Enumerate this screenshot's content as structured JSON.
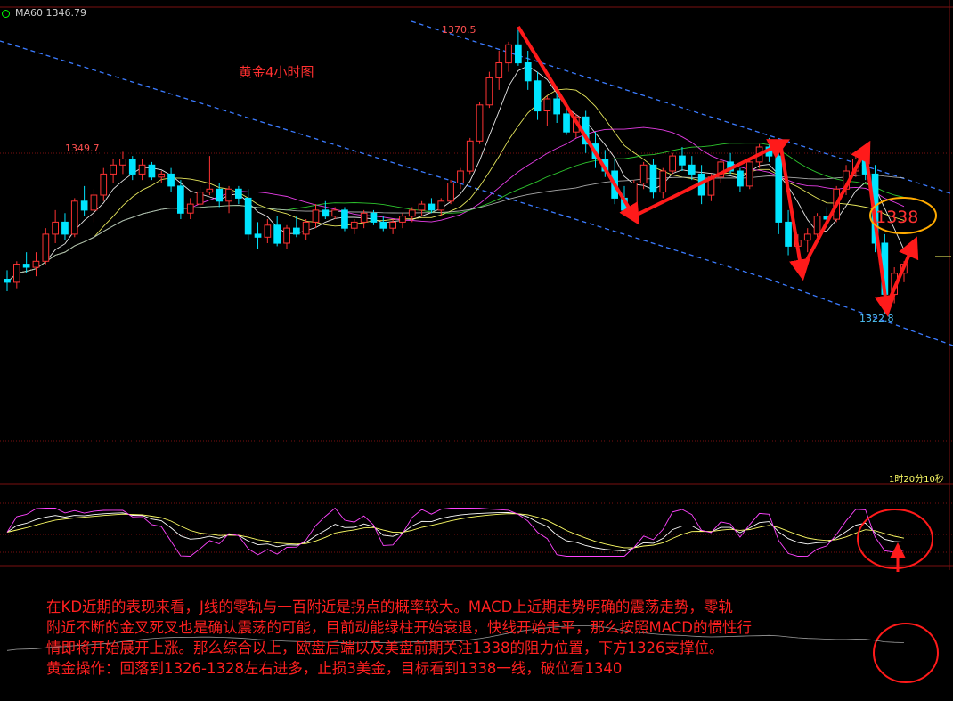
{
  "indicator_label": "MA60 1346.79",
  "title": "黄金4小时图",
  "price_labels": {
    "high": "1370.5",
    "mid_high": "1349.7",
    "low": "1322.8",
    "target": "1338"
  },
  "timer": "1时20分10秒",
  "analysis": [
    "在KD近期的表现来看，J线的零轨与一百附近是拐点的概率较大。MACD上近期走势明确的震荡走势，零轨",
    "附近不断的金叉死叉也是确认震荡的可能，目前动能绿柱开始衰退，快线开始走平，那么按照MACD的惯性行",
    "情即将开始展开上涨。那么综合以上，欧盘后端以及美盘前期关注1338的阻力位置，下方1326支撑位。",
    "黄金操作：回落到1326-1328左右进多，止损3美金，目标看到1338一线，破位看1340"
  ],
  "colors": {
    "bull": "#ff3333",
    "bear": "#00e5ff",
    "channel": "#3b7bff",
    "ma5": "#ffffff",
    "ma10": "#ffff66",
    "ma20": "#ff44ff",
    "ma30": "#33dd33",
    "ma60": "#bbbbbb",
    "annotation": "#ff1a1a",
    "highlight_circle": "#ffaa00"
  },
  "chart_data": {
    "type": "candlestick",
    "title": "黄金4小时图",
    "instrument": "黄金 (Gold)",
    "timeframe": "4H",
    "ylim": [
      1311,
      1374
    ],
    "indicators": {
      "MA60": 1346.79
    },
    "annotations": {
      "high": 1370.5,
      "local_high": 1349.7,
      "low": 1322.8,
      "target": 1338,
      "arrows": [
        "down",
        "up",
        "down",
        "up",
        "down",
        "up"
      ]
    },
    "ohlc": [
      [
        1328.5,
        1330.0,
        1326.5,
        1328.0
      ],
      [
        1328.0,
        1331.5,
        1327.0,
        1331.0
      ],
      [
        1331.0,
        1333.0,
        1329.5,
        1330.5
      ],
      [
        1330.5,
        1333.0,
        1329.0,
        1331.5
      ],
      [
        1331.5,
        1337.0,
        1331.0,
        1336.0
      ],
      [
        1336.0,
        1340.0,
        1334.5,
        1338.0
      ],
      [
        1338.0,
        1339.5,
        1335.0,
        1336.0
      ],
      [
        1336.0,
        1342.0,
        1335.5,
        1341.5
      ],
      [
        1341.5,
        1344.0,
        1339.0,
        1340.0
      ],
      [
        1340.0,
        1343.5,
        1338.0,
        1342.5
      ],
      [
        1342.5,
        1347.0,
        1341.5,
        1346.0
      ],
      [
        1346.0,
        1348.5,
        1344.5,
        1347.5
      ],
      [
        1347.5,
        1349.7,
        1346.0,
        1348.5
      ],
      [
        1348.5,
        1349.0,
        1345.0,
        1346.0
      ],
      [
        1346.0,
        1348.5,
        1345.0,
        1347.5
      ],
      [
        1347.5,
        1348.0,
        1345.0,
        1345.5
      ],
      [
        1345.5,
        1346.5,
        1344.5,
        1346.0
      ],
      [
        1346.0,
        1347.0,
        1343.0,
        1344.0
      ],
      [
        1344.0,
        1345.0,
        1338.5,
        1339.5
      ],
      [
        1339.5,
        1342.0,
        1338.5,
        1341.0
      ],
      [
        1341.0,
        1344.0,
        1340.0,
        1343.0
      ],
      [
        1343.0,
        1349.0,
        1342.5,
        1343.5
      ],
      [
        1343.5,
        1344.5,
        1340.5,
        1341.5
      ],
      [
        1341.5,
        1344.0,
        1339.5,
        1343.5
      ],
      [
        1343.5,
        1344.0,
        1341.0,
        1342.0
      ],
      [
        1342.0,
        1343.5,
        1335.0,
        1336.0
      ],
      [
        1336.0,
        1338.0,
        1333.5,
        1335.5
      ],
      [
        1335.5,
        1338.5,
        1334.5,
        1337.5
      ],
      [
        1337.5,
        1339.0,
        1334.0,
        1334.5
      ],
      [
        1334.5,
        1337.5,
        1333.5,
        1337.0
      ],
      [
        1337.0,
        1339.0,
        1335.5,
        1336.0
      ],
      [
        1336.0,
        1338.5,
        1335.0,
        1338.0
      ],
      [
        1338.0,
        1341.0,
        1337.0,
        1340.0
      ],
      [
        1340.0,
        1341.5,
        1338.5,
        1339.0
      ],
      [
        1339.0,
        1340.5,
        1338.5,
        1340.0
      ],
      [
        1340.0,
        1340.5,
        1336.5,
        1337.0
      ],
      [
        1337.0,
        1338.5,
        1336.0,
        1338.0
      ],
      [
        1338.0,
        1340.0,
        1337.0,
        1339.5
      ],
      [
        1339.5,
        1340.0,
        1337.5,
        1338.0
      ],
      [
        1338.0,
        1339.0,
        1336.5,
        1337.0
      ],
      [
        1337.0,
        1338.5,
        1336.0,
        1338.0
      ],
      [
        1338.0,
        1339.5,
        1337.0,
        1339.0
      ],
      [
        1339.0,
        1340.5,
        1338.0,
        1340.0
      ],
      [
        1340.0,
        1341.5,
        1339.0,
        1341.0
      ],
      [
        1341.0,
        1342.0,
        1339.5,
        1340.0
      ],
      [
        1340.0,
        1342.0,
        1339.0,
        1341.5
      ],
      [
        1341.5,
        1345.0,
        1341.0,
        1344.5
      ],
      [
        1344.5,
        1347.0,
        1343.5,
        1346.5
      ],
      [
        1346.5,
        1352.0,
        1346.0,
        1351.5
      ],
      [
        1351.5,
        1358.0,
        1351.0,
        1357.5
      ],
      [
        1357.5,
        1363.0,
        1357.0,
        1362.0
      ],
      [
        1362.0,
        1366.5,
        1360.0,
        1364.5
      ],
      [
        1364.5,
        1368.0,
        1363.0,
        1367.5
      ],
      [
        1367.5,
        1370.5,
        1364.0,
        1364.5
      ],
      [
        1364.5,
        1366.5,
        1360.0,
        1361.5
      ],
      [
        1361.5,
        1363.0,
        1355.0,
        1356.5
      ],
      [
        1356.5,
        1359.0,
        1354.0,
        1358.5
      ],
      [
        1358.5,
        1360.0,
        1354.5,
        1356.0
      ],
      [
        1356.0,
        1358.0,
        1352.5,
        1353.0
      ],
      [
        1353.0,
        1356.0,
        1352.0,
        1355.5
      ],
      [
        1355.5,
        1356.5,
        1349.5,
        1351.0
      ],
      [
        1351.0,
        1353.0,
        1347.0,
        1348.5
      ],
      [
        1348.5,
        1350.0,
        1345.5,
        1346.5
      ],
      [
        1346.5,
        1348.5,
        1341.0,
        1342.0
      ],
      [
        1342.0,
        1344.0,
        1339.0,
        1340.0
      ],
      [
        1340.0,
        1345.0,
        1339.5,
        1344.5
      ],
      [
        1344.5,
        1348.0,
        1343.5,
        1347.5
      ],
      [
        1347.5,
        1348.5,
        1342.0,
        1343.0
      ],
      [
        1343.0,
        1347.0,
        1342.0,
        1346.5
      ],
      [
        1346.5,
        1349.5,
        1346.0,
        1349.0
      ],
      [
        1349.0,
        1350.5,
        1346.5,
        1347.5
      ],
      [
        1347.5,
        1349.0,
        1345.0,
        1346.0
      ],
      [
        1346.0,
        1347.5,
        1341.0,
        1342.5
      ],
      [
        1342.5,
        1346.0,
        1341.5,
        1345.5
      ],
      [
        1345.5,
        1348.5,
        1344.5,
        1348.0
      ],
      [
        1348.0,
        1349.5,
        1346.0,
        1346.5
      ],
      [
        1346.5,
        1347.0,
        1343.0,
        1344.0
      ],
      [
        1344.0,
        1348.5,
        1343.5,
        1348.0
      ],
      [
        1348.0,
        1351.0,
        1347.0,
        1350.5
      ],
      [
        1350.5,
        1352.0,
        1348.0,
        1349.0
      ],
      [
        1349.0,
        1350.0,
        1336.0,
        1338.0
      ],
      [
        1338.0,
        1340.0,
        1332.5,
        1334.0
      ],
      [
        1334.0,
        1336.0,
        1332.0,
        1335.0
      ],
      [
        1335.0,
        1337.0,
        1333.0,
        1336.0
      ],
      [
        1336.0,
        1339.5,
        1335.5,
        1339.0
      ],
      [
        1339.0,
        1340.5,
        1337.0,
        1338.5
      ],
      [
        1338.5,
        1344.0,
        1338.0,
        1343.5
      ],
      [
        1343.5,
        1347.5,
        1342.5,
        1346.5
      ],
      [
        1346.5,
        1349.5,
        1345.5,
        1348.5
      ],
      [
        1348.5,
        1349.0,
        1345.0,
        1346.0
      ],
      [
        1346.0,
        1347.5,
        1333.0,
        1334.5
      ],
      [
        1334.5,
        1336.0,
        1322.8,
        1326.0
      ],
      [
        1326.0,
        1330.5,
        1324.5,
        1329.5
      ],
      [
        1329.5,
        1331.5,
        1328.0,
        1331.0
      ]
    ],
    "macd_panel": {
      "series": [
        "K",
        "D",
        "J"
      ]
    }
  }
}
